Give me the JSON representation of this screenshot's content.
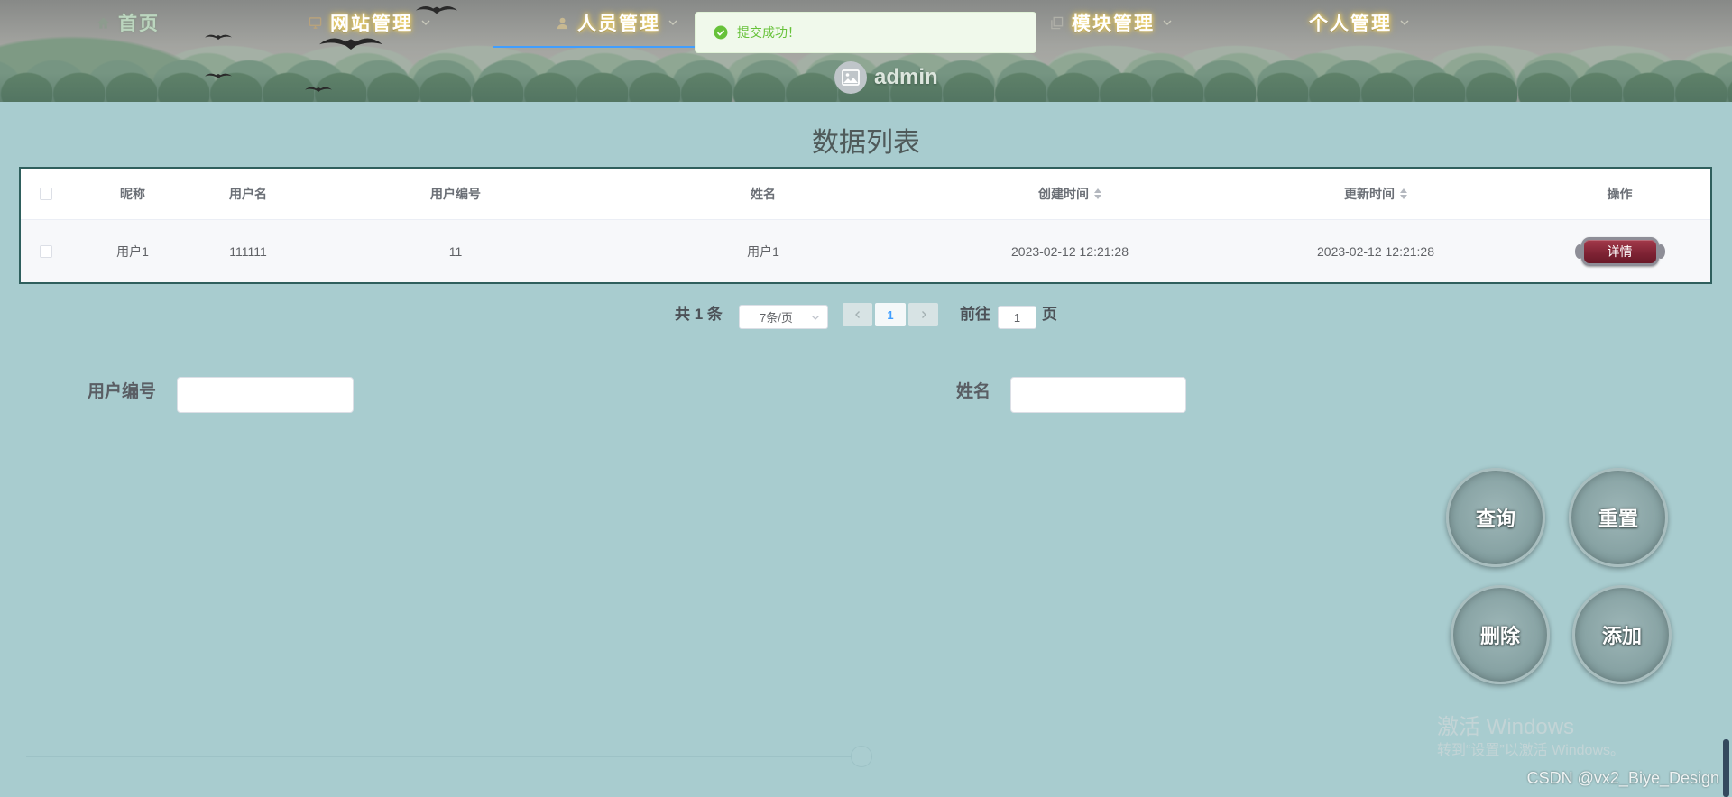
{
  "header": {
    "nav_items": [
      {
        "label": "首页",
        "icon": "home-icon"
      },
      {
        "label": "网站管理",
        "icon": "monitor-icon",
        "has_dropdown": true
      },
      {
        "label": "人员管理",
        "icon": "user-icon",
        "has_dropdown": true,
        "active": true
      },
      {
        "label": "模块管理",
        "icon": "copy-icon",
        "has_dropdown": true
      },
      {
        "label": "个人管理",
        "has_dropdown": true
      }
    ],
    "user": {
      "name": "admin",
      "avatar_icon": "picture-icon"
    }
  },
  "toast": {
    "icon": "circle-check-icon",
    "message": "提交成功！"
  },
  "page_title": "数据列表",
  "table": {
    "columns": [
      {
        "label": "昵称"
      },
      {
        "label": "用户名"
      },
      {
        "label": "用户编号"
      },
      {
        "label": "姓名"
      },
      {
        "label": "创建时间",
        "sortable": true
      },
      {
        "label": "更新时间",
        "sortable": true
      },
      {
        "label": "操作"
      }
    ],
    "rows": [
      {
        "nickname": "用户1",
        "username": "111111",
        "user_number": "11",
        "name": "用户1",
        "created_at": "2023-02-12 12:21:28",
        "updated_at": "2023-02-12 12:21:28",
        "action": "详情"
      }
    ]
  },
  "pagination": {
    "total_text": "共 1 条",
    "page_size": "7条/页",
    "current_page": "1",
    "goto_label": "前往",
    "goto_value": "1",
    "goto_suffix": "页"
  },
  "search": {
    "fields": [
      {
        "label": "用户编号",
        "value": ""
      },
      {
        "label": "姓名",
        "value": ""
      }
    ]
  },
  "actions": {
    "query": "查询",
    "reset": "重置",
    "delete": "删除",
    "add": "添加"
  },
  "bottom_slider": {
    "value_fraction": 1.0
  },
  "watermarks": {
    "windows_title": "激活 Windows",
    "windows_subtitle": "转到“设置”以激活 Windows。",
    "csdn": "CSDN @vx2_Biye_Design"
  },
  "colors": {
    "page_bg": "#a8cccf",
    "active_nav_underline": "#409eff",
    "toast_success": "#67c23a",
    "detail_button": "#7d2233",
    "table_border": "#2f5f5d"
  }
}
